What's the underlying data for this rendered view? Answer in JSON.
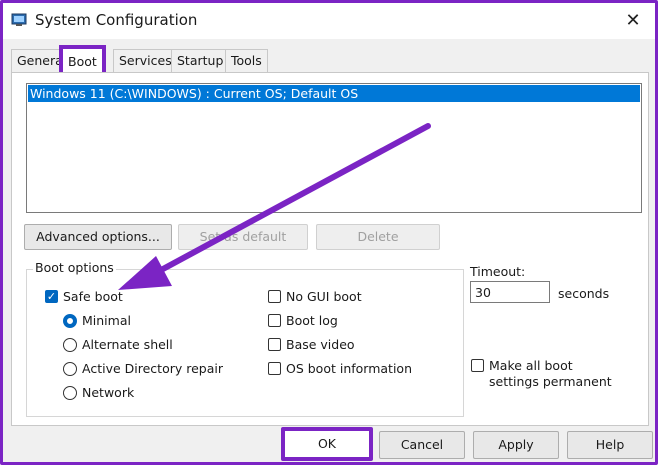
{
  "window": {
    "title": "System Configuration",
    "close_glyph": "✕"
  },
  "tabs": [
    "General",
    "Boot",
    "Services",
    "Startup",
    "Tools"
  ],
  "os_list": [
    "Windows 11 (C:\\WINDOWS) : Current OS; Default OS"
  ],
  "list_buttons": {
    "advanced": "Advanced options...",
    "set_default": "Set as default",
    "delete": "Delete"
  },
  "boot_options": {
    "label": "Boot options",
    "safe_boot": "Safe boot",
    "minimal": "Minimal",
    "alternate_shell": "Alternate shell",
    "active_directory_repair": "Active Directory repair",
    "network": "Network",
    "no_gui_boot": "No GUI boot",
    "boot_log": "Boot log",
    "base_video": "Base video",
    "os_boot_information": "OS boot information"
  },
  "timeout": {
    "label": "Timeout:",
    "value": "30",
    "unit": "seconds"
  },
  "make_permanent": "Make all boot settings permanent",
  "dialog_buttons": {
    "ok": "OK",
    "cancel": "Cancel",
    "apply": "Apply",
    "help": "Help"
  },
  "colors": {
    "annotation": "#7b24c4",
    "selection": "#0078d7"
  }
}
